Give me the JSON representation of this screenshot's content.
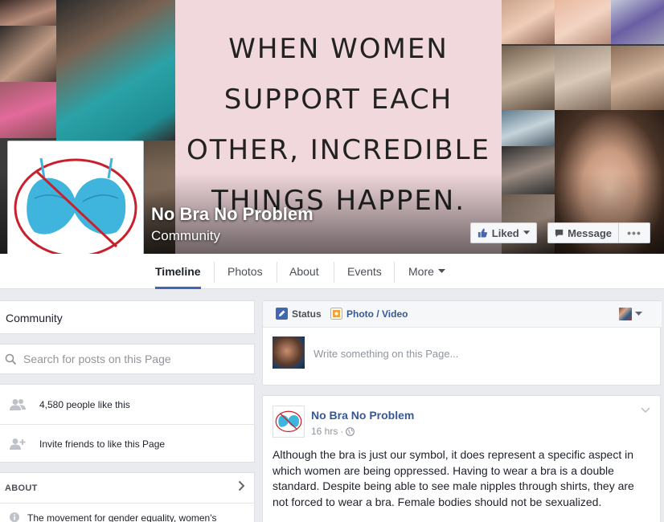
{
  "cover": {
    "quote_lines": "WHEN WOMEN\nSUPPORT EACH\nOTHER, INCREDIBLE\nTHINGS HAPPEN."
  },
  "page": {
    "name": "No Bra No Problem",
    "category": "Community"
  },
  "actions": {
    "liked_label": "Liked",
    "message_label": "Message",
    "more_label": "•••"
  },
  "tabs": [
    {
      "label": "Timeline",
      "active": true
    },
    {
      "label": "Photos"
    },
    {
      "label": "About"
    },
    {
      "label": "Events"
    },
    {
      "label": "More"
    }
  ],
  "sidebar": {
    "category": "Community",
    "search_placeholder": "Search for posts on this Page",
    "likes_text": "4,580 people like this",
    "invite_text": "Invite friends to like this Page",
    "about_heading": "ABOUT",
    "about_text": "The movement for gender equality, women's"
  },
  "composer": {
    "status_label": "Status",
    "photo_label": "Photo / Video",
    "placeholder": "Write something on this Page..."
  },
  "post": {
    "author": "No Bra No Problem",
    "time": "16 hrs",
    "separator": "·",
    "text": "Although the bra is just our symbol, it does represent a specific aspect in which women are being oppressed. Having to wear a bra is a double standard. Despite being able to see male nipples through shirts, they are not forced to wear a bra. Female bodies should not be sexualized."
  },
  "colors": {
    "brand_blue": "#4267b2",
    "link_blue": "#365899",
    "bra_blue": "#3fb4dd",
    "prohibit_red": "#c8202c"
  }
}
